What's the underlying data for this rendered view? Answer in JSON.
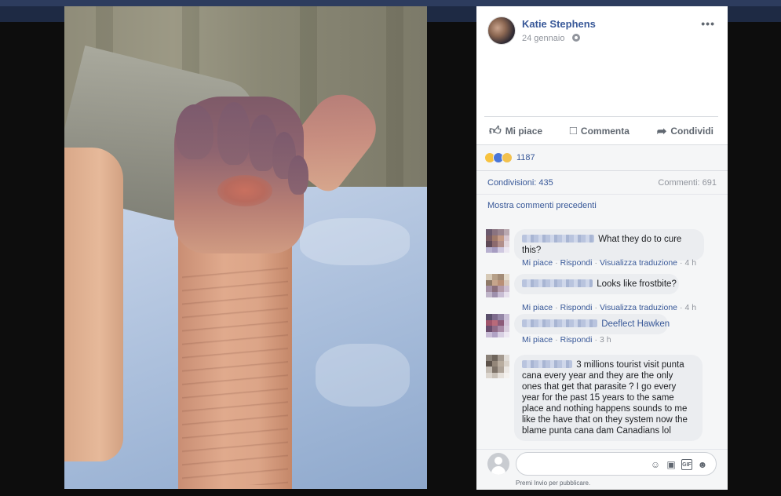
{
  "post": {
    "author": "Katie Stephens",
    "date": "24 gennaio",
    "more_label": "•••"
  },
  "actions": {
    "like": "Mi piace",
    "comment": "Commenta",
    "share": "Condividi"
  },
  "reactions": {
    "count": "1187"
  },
  "stats": {
    "shares": "Condivisioni: 435",
    "comments": "Commenti: 691"
  },
  "comments_section": {
    "previous_link": "Mostra commenti precedenti",
    "items": [
      {
        "text": "What they do to cure this?",
        "actions": [
          "Mi piace",
          "Rispondi",
          "Visualizza traduzione"
        ],
        "time": "4 h"
      },
      {
        "text": "Looks like frostbite?",
        "actions": [
          "Mi piace",
          "Rispondi",
          "Visualizza traduzione"
        ],
        "time": "4 h"
      },
      {
        "text": "Deeflect Hawken",
        "actions": [
          "Mi piace",
          "Rispondi"
        ],
        "time": "3 h"
      },
      {
        "text": "3 millions tourist visit punta cana every year and they are the only ones that get that parasite ? I go every year for the past 15 years to the same place and nothing happens sounds to me like the have that on they system now the blame punta cana dam Canadians lol",
        "actions": [],
        "time": ""
      }
    ]
  },
  "composer": {
    "hint": "Premi Invio per pubblicare.",
    "icons": [
      "emoji-icon",
      "camera-icon",
      "gif-icon",
      "sticker-icon"
    ]
  },
  "colors": {
    "link": "#385898",
    "muted": "#90949c",
    "panel_bg": "#f5f6f7",
    "bubble_bg": "#ebedf0"
  }
}
